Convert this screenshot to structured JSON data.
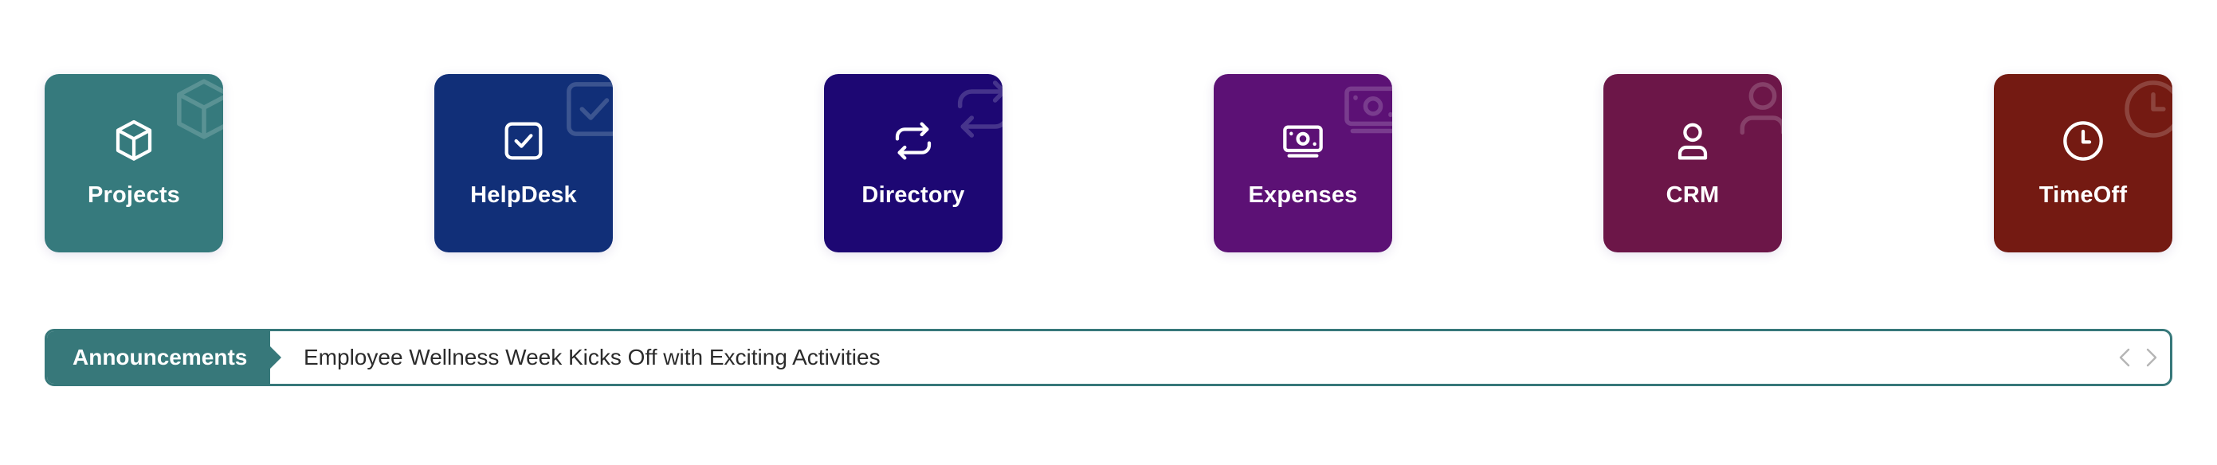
{
  "tiles": [
    {
      "label": "Projects",
      "icon": "cube-icon",
      "color": "#367a7d"
    },
    {
      "label": "HelpDesk",
      "icon": "checkbox-icon",
      "color": "#112f78"
    },
    {
      "label": "Directory",
      "icon": "repeat-icon",
      "color": "#1d0773"
    },
    {
      "label": "Expenses",
      "icon": "banknote-icon",
      "color": "#5c1175"
    },
    {
      "label": "CRM",
      "icon": "user-icon",
      "color": "#6c1648"
    },
    {
      "label": "TimeOff",
      "icon": "clock-icon",
      "color": "#741a12"
    }
  ],
  "announcements": {
    "label": "Announcements",
    "headline": "Employee Wellness Week Kicks Off with Exciting Activities",
    "accent_color": "#37787a",
    "prev_icon": "chevron-left-icon",
    "next_icon": "chevron-right-icon"
  }
}
